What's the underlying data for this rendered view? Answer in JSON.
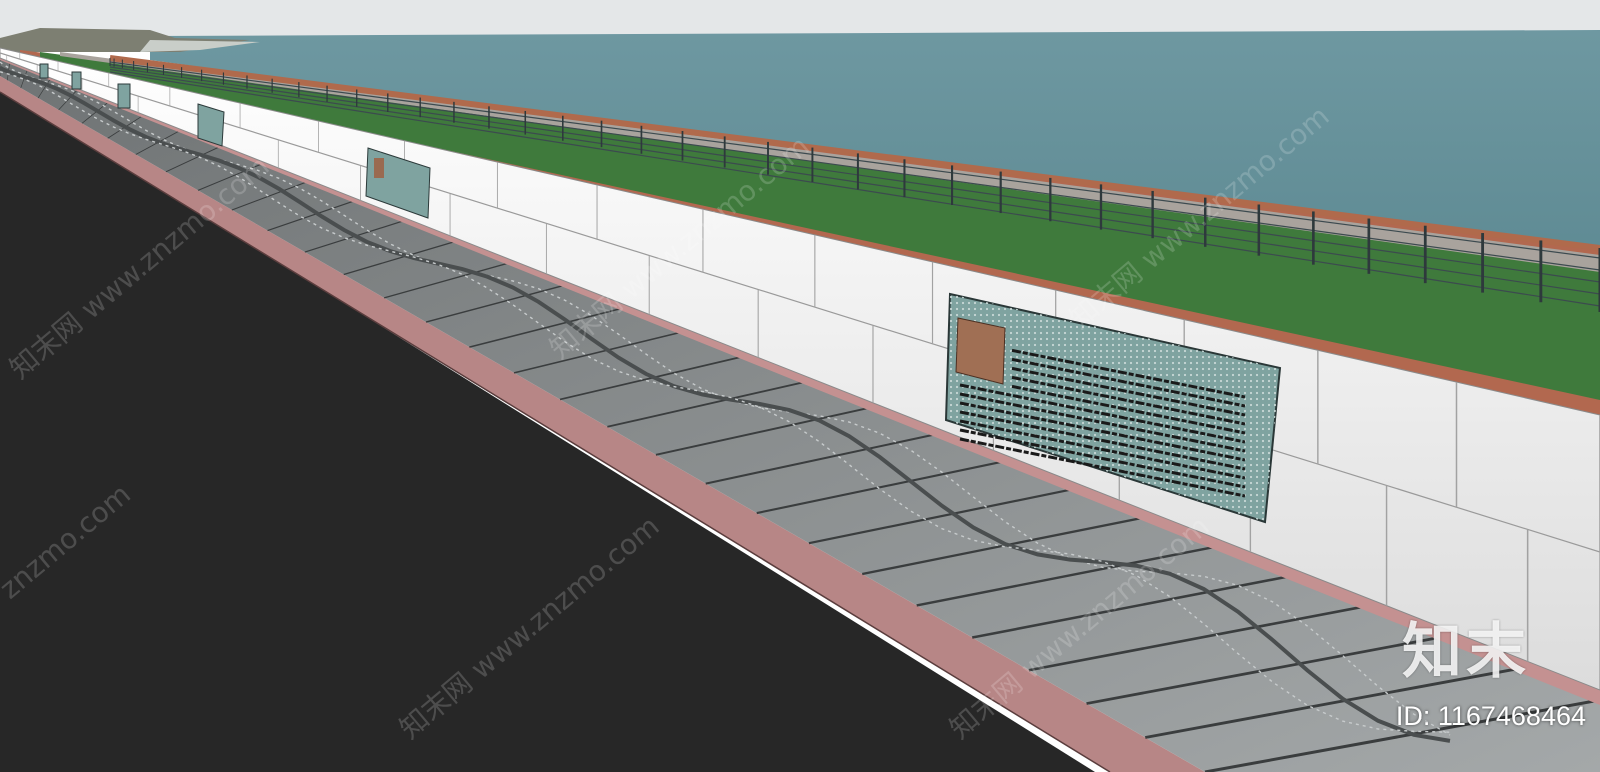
{
  "scene": {
    "colors": {
      "sky": "#e4e7e8",
      "water": "#66919a",
      "road": "#272727",
      "curb": "#b78686",
      "paving": "#8f9394",
      "wall": "#f2f2f2",
      "grass": "#3f7a3c",
      "soil": "#b2684f",
      "railing": "#3c4a4f",
      "sign_panel": "#7fa3a0"
    },
    "icons": [
      "wave-pattern-icon",
      "sign-board-icon",
      "railing-icon"
    ]
  },
  "brand": {
    "logo_text": "知末",
    "id_text": "ID: 1167468464"
  },
  "watermarks": [
    "知末网 www.znzmo.com",
    "znzmo.com"
  ]
}
